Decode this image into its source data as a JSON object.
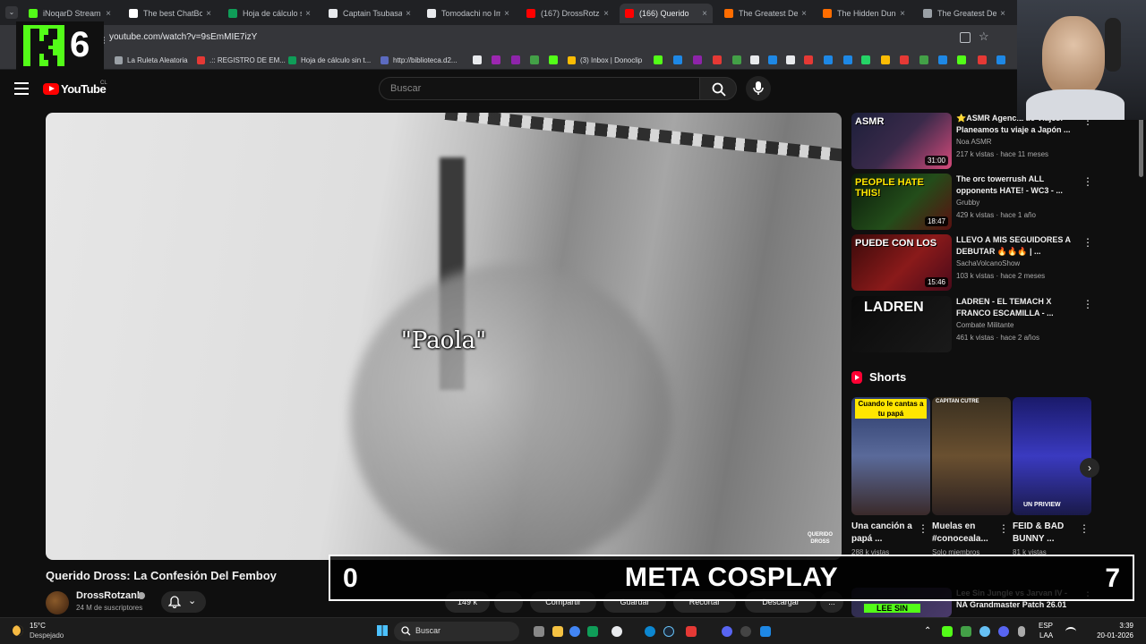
{
  "browser": {
    "tabs": [
      {
        "label": "iNoqarD Stream",
        "color": "#53fc18"
      },
      {
        "label": "The best ChatBot",
        "color": "#ffffff"
      },
      {
        "label": "Hoja de cálculo si",
        "color": "#0f9d58"
      },
      {
        "label": "Captain Tsubasa (",
        "color": "#e8eaed"
      },
      {
        "label": "Tomodachi no Ime",
        "color": "#e8eaed"
      },
      {
        "label": "(167) DrossRotzan",
        "color": "#ff0000"
      },
      {
        "label": "(166) Querido",
        "color": "#ff0000"
      },
      {
        "label": "The Greatest Den",
        "color": "#ff6d00"
      },
      {
        "label": "The Hidden Dung",
        "color": "#ff6d00"
      },
      {
        "label": "The Greatest Den",
        "color": "#9aa0a6"
      }
    ],
    "url": "youtube.com/watch?v=9sEmMIE7izY",
    "bookmarks": [
      {
        "label": "La Ruleta Aleatoria",
        "color": "#9aa0a6"
      },
      {
        "label": ".:: REGISTRO DE EM...",
        "color": "#e53935"
      },
      {
        "label": "Hoja de cálculo sin t...",
        "color": "#0f9d58"
      },
      {
        "label": "http://biblioteca.d2...",
        "color": "#5c6bc0"
      },
      {
        "label": "(3) Inbox | Donoclip",
        "color": "#fbbc04"
      }
    ]
  },
  "overlay_logo": {
    "letter": "K",
    "number": "6"
  },
  "youtube": {
    "logo_text": "YouTube",
    "country": "CL",
    "search_placeholder": "Buscar"
  },
  "video": {
    "subtitle": "\"Paola\"",
    "watermark": "QUERIDO DROSS",
    "title": "Querido Dross: La Confesión Del Femboy",
    "channel": "DrossRotzank",
    "subscribers": "24 M de suscriptores",
    "actions": [
      {
        "label": "149 k"
      },
      {
        "label": ""
      },
      {
        "label": "Compartir"
      },
      {
        "label": "Guardar"
      },
      {
        "label": "Recortar"
      },
      {
        "label": "Descargar"
      },
      {
        "label": "..."
      }
    ]
  },
  "banner": {
    "left": "0",
    "center": "META COSPLAY",
    "right": "7"
  },
  "recommendations": [
    {
      "title": "⭐ASMR Agencia de Viajes: Planeamos tu viaje a Japón ...",
      "channel": "Noa ASMR",
      "meta": "217 k vistas · hace 11 meses",
      "duration": "31:00",
      "thumb_text": "ASMR"
    },
    {
      "title": "The orc towerrush ALL opponents HATE! - WC3 - ...",
      "channel": "Grubby",
      "meta": "429 k vistas · hace 1 año",
      "duration": "18:47",
      "thumb_text": "PEOPLE HATE THIS!"
    },
    {
      "title": "LLEVO A MIS SEGUIDORES A DEBUTAR 🔥🔥🔥 | ...",
      "channel": "SachaVolcanoShow",
      "meta": "103 k vistas · hace 2 meses",
      "duration": "15:46",
      "thumb_text": "PUEDE CON LOS"
    },
    {
      "title": "LADREN - EL TEMACH X FRANCO ESCAMILLA - ...",
      "channel": "Combate Militante",
      "meta": "461 k vistas · hace 2 años",
      "duration": "",
      "thumb_text": "LADREN"
    },
    {
      "title": "Lee Sin Jungle vs Jarvan IV - NA Grandmaster Patch 26.01",
      "channel": "",
      "meta": "",
      "duration": "",
      "thumb_text": "LEE SIN"
    }
  ],
  "shorts": {
    "label": "Shorts",
    "items": [
      {
        "title": "Una canción a papá ...",
        "meta": "288 k vistas",
        "thumb_text": "Cuando le cantas a tu papá"
      },
      {
        "title": "Muelas en #conoceala...",
        "meta": "Solo miembros",
        "thumb_text": "CAPITAN CUTRE"
      },
      {
        "title": "FEID & BAD BUNNY ...",
        "meta": "81 k vistas",
        "thumb_text": "UN PRIVIEW"
      }
    ]
  },
  "taskbar": {
    "weather_temp": "15°C",
    "weather_desc": "Despejado",
    "search": "Buscar",
    "lang": "ESP",
    "lang2": "LAA",
    "time": "3:39",
    "date": "20-01-2026"
  }
}
